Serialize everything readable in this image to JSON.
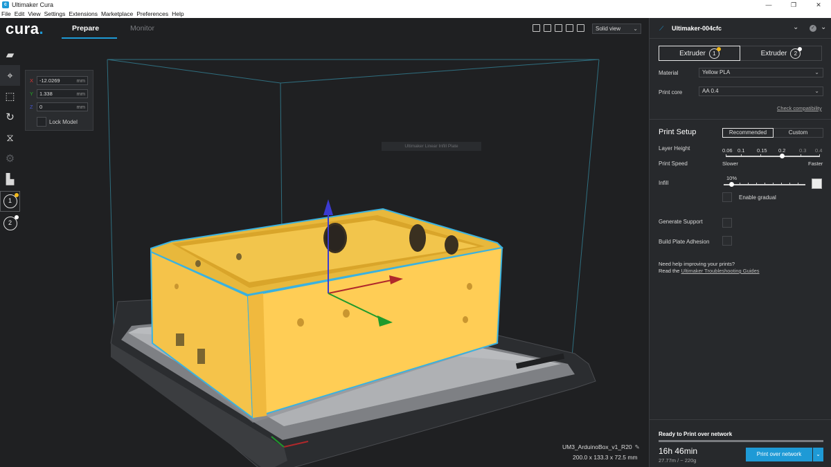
{
  "window": {
    "title": "Ultimaker Cura",
    "controls": [
      "—",
      "❐",
      "✕"
    ]
  },
  "menu": [
    "File",
    "Edit",
    "View",
    "Settings",
    "Extensions",
    "Marketplace",
    "Preferences",
    "Help"
  ],
  "brand": {
    "logo": "cura",
    "dot": "."
  },
  "tabs": {
    "prepare": "Prepare",
    "monitor": "Monitor"
  },
  "view": {
    "selected": "Solid view"
  },
  "move_tool": {
    "x_label": "X",
    "x_value": "-12.0269",
    "y_label": "Y",
    "y_value": "1.338",
    "z_label": "Z",
    "z_value": "0",
    "unit": "mm",
    "lock_label": "Lock Model"
  },
  "toolbar": {
    "extruder1": "1",
    "extruder2": "2"
  },
  "viewport": {
    "tooltip": "Ultimaker Linear Infill Plate",
    "job_name": "UM3_ArduinoBox_v1_R20",
    "dimensions": "200.0 x 133.3 x 72.5 mm"
  },
  "sidebar": {
    "printer_name": "Ultimaker-004cfc",
    "extruders": [
      {
        "label": "Extruder",
        "num": "1"
      },
      {
        "label": "Extruder",
        "num": "2"
      }
    ],
    "material_label": "Material",
    "material_value": "Yellow PLA",
    "core_label": "Print core",
    "core_value": "AA 0.4",
    "compat_link": "Check compatibility",
    "setup_title": "Print Setup",
    "mode_recommended": "Recommended",
    "mode_custom": "Custom",
    "layer_height_label": "Layer Height",
    "layer_heights": [
      "0.06",
      "0.1",
      "0.15",
      "0.2",
      "0.3",
      "0.4"
    ],
    "layer_height_selected": "0.2",
    "print_speed_label": "Print Speed",
    "slower": "Slower",
    "faster": "Faster",
    "infill_label": "Infill",
    "infill_percent": "10%",
    "gradual_label": "Enable gradual",
    "support_label": "Generate Support",
    "adhesion_label": "Build Plate Adhesion",
    "help_line1": "Need help improving your prints?",
    "help_line2_prefix": "Read the",
    "help_link": "Ultimaker Troubleshooting Guides",
    "ready_text": "Ready to Print over network",
    "print_time": "16h 46min",
    "print_stats": "27.77m / ~ 220g",
    "print_button": "Print over network"
  },
  "colors": {
    "accent": "#1e9ad6",
    "model": "#f7c544",
    "outline": "#3ab2e0",
    "background": "#1f2022",
    "panel": "#27292c"
  }
}
